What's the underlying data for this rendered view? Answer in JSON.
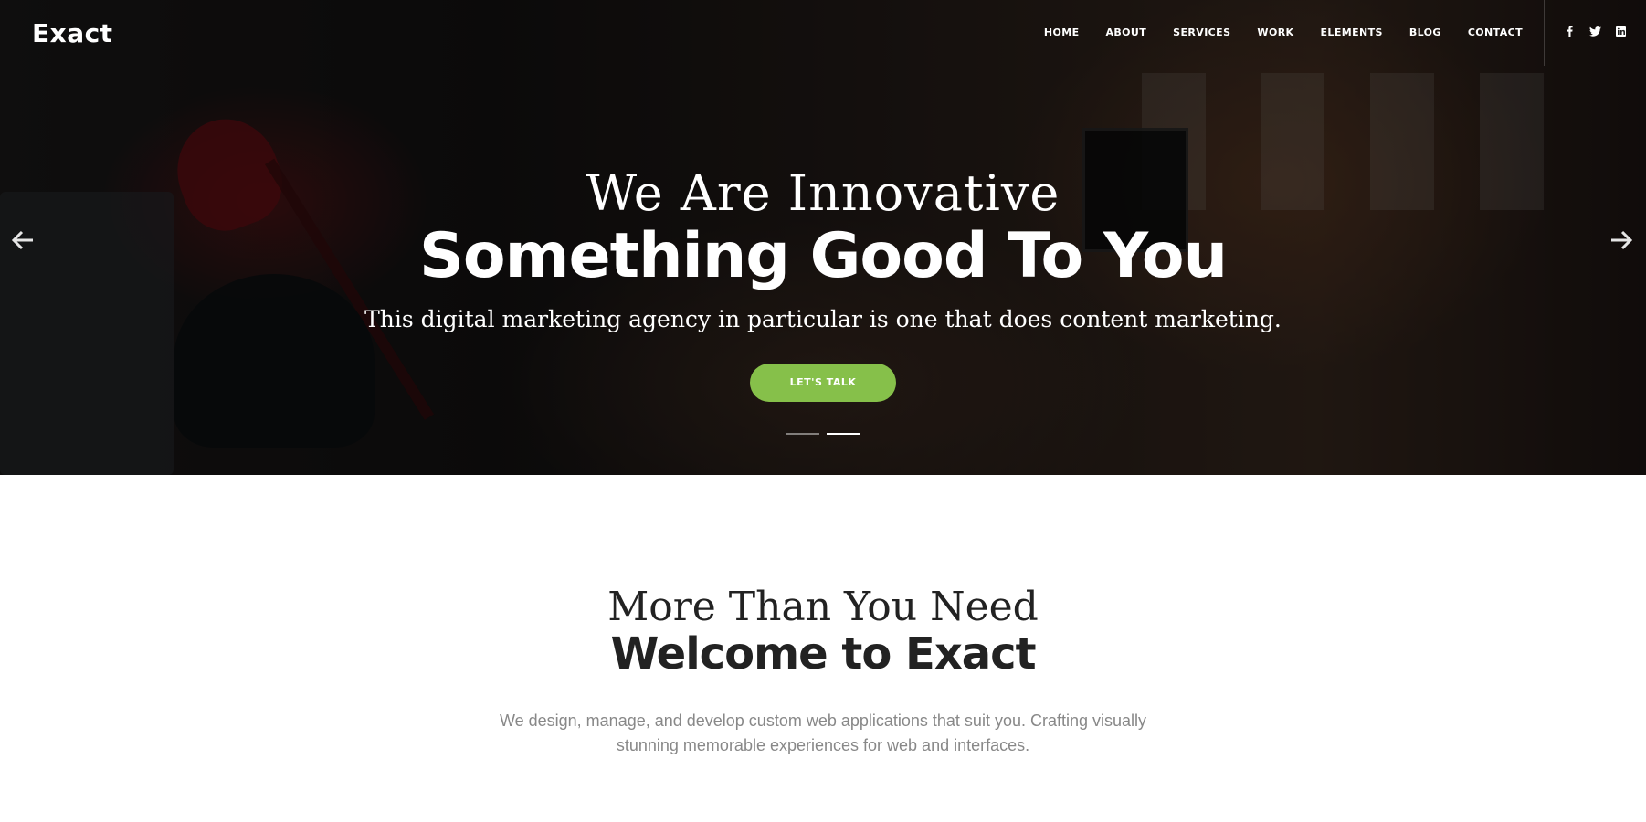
{
  "brand": {
    "logo": "Exact"
  },
  "nav": {
    "items": [
      "HOME",
      "ABOUT",
      "SERVICES",
      "WORK",
      "ELEMENTS",
      "BLOG",
      "CONTACT"
    ]
  },
  "social": {
    "facebook": "f",
    "twitter": "t",
    "linkedin": "in"
  },
  "hero": {
    "subtitle": "We Are Innovative",
    "title": "Something Good To You",
    "description": "This digital marketing agency in particular is one that does content marketing.",
    "cta": "LET'S TALK",
    "slides": {
      "count": 2,
      "active": 2
    }
  },
  "welcome": {
    "subtitle": "More Than You Need",
    "title": "Welcome to Exact",
    "description": "We design, manage, and develop custom web applications that suit you. Crafting visually stunning memorable experiences for web and interfaces."
  },
  "colors": {
    "accent": "#86c04a",
    "text_dark": "#222222",
    "text_muted": "#888888"
  },
  "icons": {
    "prev": "arrow-left-icon",
    "next": "arrow-right-icon"
  }
}
